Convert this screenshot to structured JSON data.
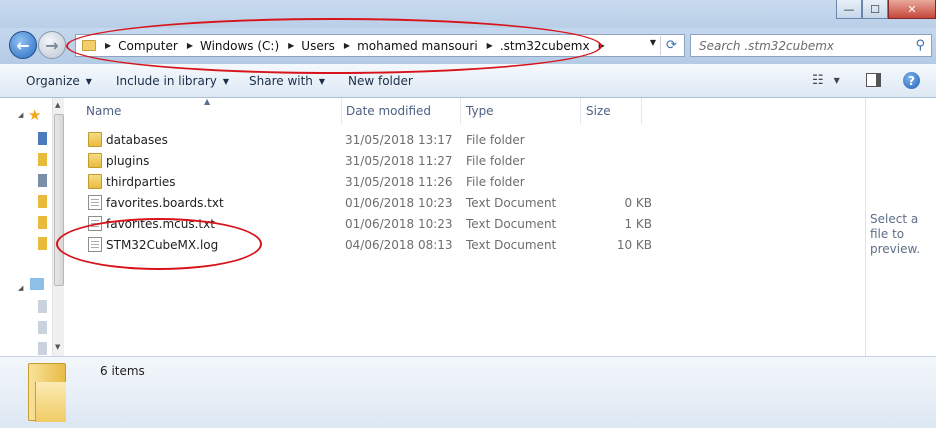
{
  "window": {
    "minimize_glyph": "—",
    "maximize_glyph": "☐",
    "close_glyph": "✕"
  },
  "address": {
    "crumbs": [
      "Computer",
      "Windows (C:)",
      "Users",
      "mohamed mansouri",
      ".stm32cubemx"
    ]
  },
  "search": {
    "placeholder": "Search .stm32cubemx"
  },
  "toolbar": {
    "organize": "Organize",
    "include_in_library": "Include in library",
    "share_with": "Share with",
    "new_folder": "New folder"
  },
  "columns": {
    "name": "Name",
    "date_modified": "Date modified",
    "type": "Type",
    "size": "Size"
  },
  "files": [
    {
      "name": "databases",
      "date": "31/05/2018 13:17",
      "type": "File folder",
      "size": "",
      "icon": "folder-icon"
    },
    {
      "name": "plugins",
      "date": "31/05/2018 11:27",
      "type": "File folder",
      "size": "",
      "icon": "folder-icon"
    },
    {
      "name": "thirdparties",
      "date": "31/05/2018 11:26",
      "type": "File folder",
      "size": "",
      "icon": "folder-icon"
    },
    {
      "name": "favorites.boards.txt",
      "date": "01/06/2018 10:23",
      "type": "Text Document",
      "size": "0 KB",
      "icon": "text-document-icon"
    },
    {
      "name": "favorites.mcus.txt",
      "date": "01/06/2018 10:23",
      "type": "Text Document",
      "size": "1 KB",
      "icon": "text-document-icon"
    },
    {
      "name": "STM32CubeMX.log",
      "date": "04/06/2018 08:13",
      "type": "Text Document",
      "size": "10 KB",
      "icon": "text-document-icon"
    }
  ],
  "preview": {
    "text": "Select a file to preview."
  },
  "details": {
    "items_count": "6 items"
  },
  "annotations": {
    "color": "#d8141a"
  }
}
